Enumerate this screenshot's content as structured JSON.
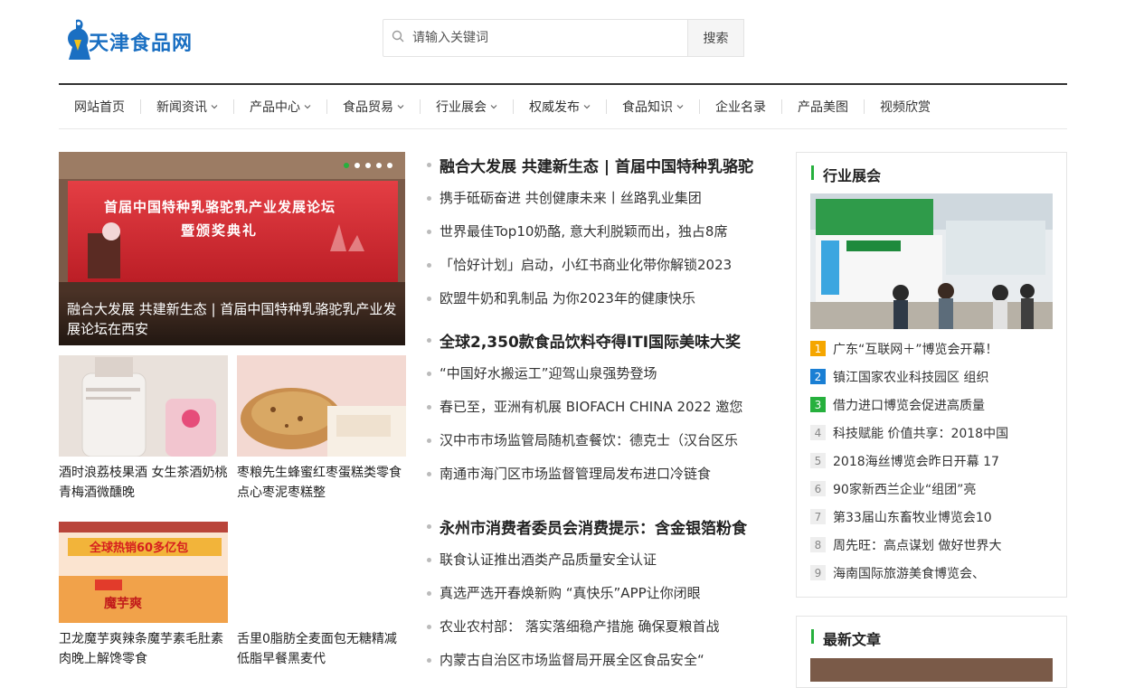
{
  "site": {
    "logo_text": "天津食品网"
  },
  "search": {
    "placeholder": "请输入关键词",
    "button": "搜索"
  },
  "nav": [
    {
      "label": "网站首页",
      "dropdown": false
    },
    {
      "label": "新闻资讯",
      "dropdown": true
    },
    {
      "label": "产品中心",
      "dropdown": true
    },
    {
      "label": "食品贸易",
      "dropdown": true
    },
    {
      "label": "行业展会",
      "dropdown": true
    },
    {
      "label": "权威发布",
      "dropdown": true
    },
    {
      "label": "食品知识",
      "dropdown": true
    },
    {
      "label": "企业名录",
      "dropdown": false
    },
    {
      "label": "产品美图",
      "dropdown": false
    },
    {
      "label": "视频欣赏",
      "dropdown": false
    }
  ],
  "hero": {
    "caption": "融合大发展 共建新生态 | 首届中国特种乳骆驼乳产业发展论坛在西安",
    "banner_line1": "首届中国特种乳骆驼乳产业发展论坛",
    "banner_line2": "暨颁奖典礼",
    "dots": 5,
    "active_dot": 0
  },
  "thumbs": [
    {
      "title": "酒时浪荔枝果酒 女生茶酒奶桃青梅酒微醺晚"
    },
    {
      "title": "枣粮先生蜂蜜红枣蛋糕类零食点心枣泥枣糕整"
    },
    {
      "title": "卫龙魔芋爽辣条魔芋素毛肚素肉晚上解馋零食",
      "box_text": "全球热销60多亿包",
      "brand": "魔芋爽"
    },
    {
      "title": "舌里0脂肪全麦面包无糖精减低脂早餐黑麦代"
    }
  ],
  "news_groups": [
    {
      "headline": "融合大发展 共建新生态 | 首届中国特种乳骆驼",
      "items": [
        "携手砥砺奋进 共创健康未来丨丝路乳业集团",
        "世界最佳Top10奶酪, 意大利脱颖而出，独占8席",
        "「恰好计划」启动，小红书商业化带你解锁2023",
        "欧盟牛奶和乳制品 为你2023年的健康快乐"
      ]
    },
    {
      "headline": "全球2,350款食品饮料夺得ITI国际美味大奖",
      "items": [
        "“中国好水搬运工”迎驾山泉强势登场",
        "春已至，亚洲有机展 BIOFACH CHINA 2022 邀您",
        "汉中市市场监管局随机查餐饮：德克士（汉台区乐",
        "南通市海门区市场监督管理局发布进口冷链食"
      ]
    },
    {
      "headline": "永州市消费者委员会消费提示：含金银箔粉食",
      "items": [
        "联食认证推出酒类产品质量安全认证",
        "真选严选开春焕新购 “真快乐”APP让你闭眼",
        "农业农村部： 落实落细稳产措施 确保夏粮首战",
        "内蒙古自治区市场监督局开展全区食品安全“"
      ]
    }
  ],
  "expo": {
    "title": "行业展会",
    "ranks": [
      {
        "num": "1",
        "text": "广东“互联网＋”博览会开幕！",
        "color": "#f5a600"
      },
      {
        "num": "2",
        "text": "镇江国家农业科技园区 组织",
        "color": "#1a7fd4"
      },
      {
        "num": "3",
        "text": "借力进口博览会促进高质量",
        "color": "#26b03d"
      },
      {
        "num": "4",
        "text": "科技赋能 价值共享：2018中国",
        "color": "#eee"
      },
      {
        "num": "5",
        "text": "2018海丝博览会昨日开幕 17",
        "color": "#eee"
      },
      {
        "num": "6",
        "text": "90家新西兰企业“组团”亮",
        "color": "#eee"
      },
      {
        "num": "7",
        "text": "第33届山东畜牧业博览会10",
        "color": "#eee"
      },
      {
        "num": "8",
        "text": "周先旺：高点谋划 做好世界大",
        "color": "#eee"
      },
      {
        "num": "9",
        "text": "海南国际旅游美食博览会、",
        "color": "#eee"
      }
    ]
  },
  "latest": {
    "title": "最新文章"
  }
}
